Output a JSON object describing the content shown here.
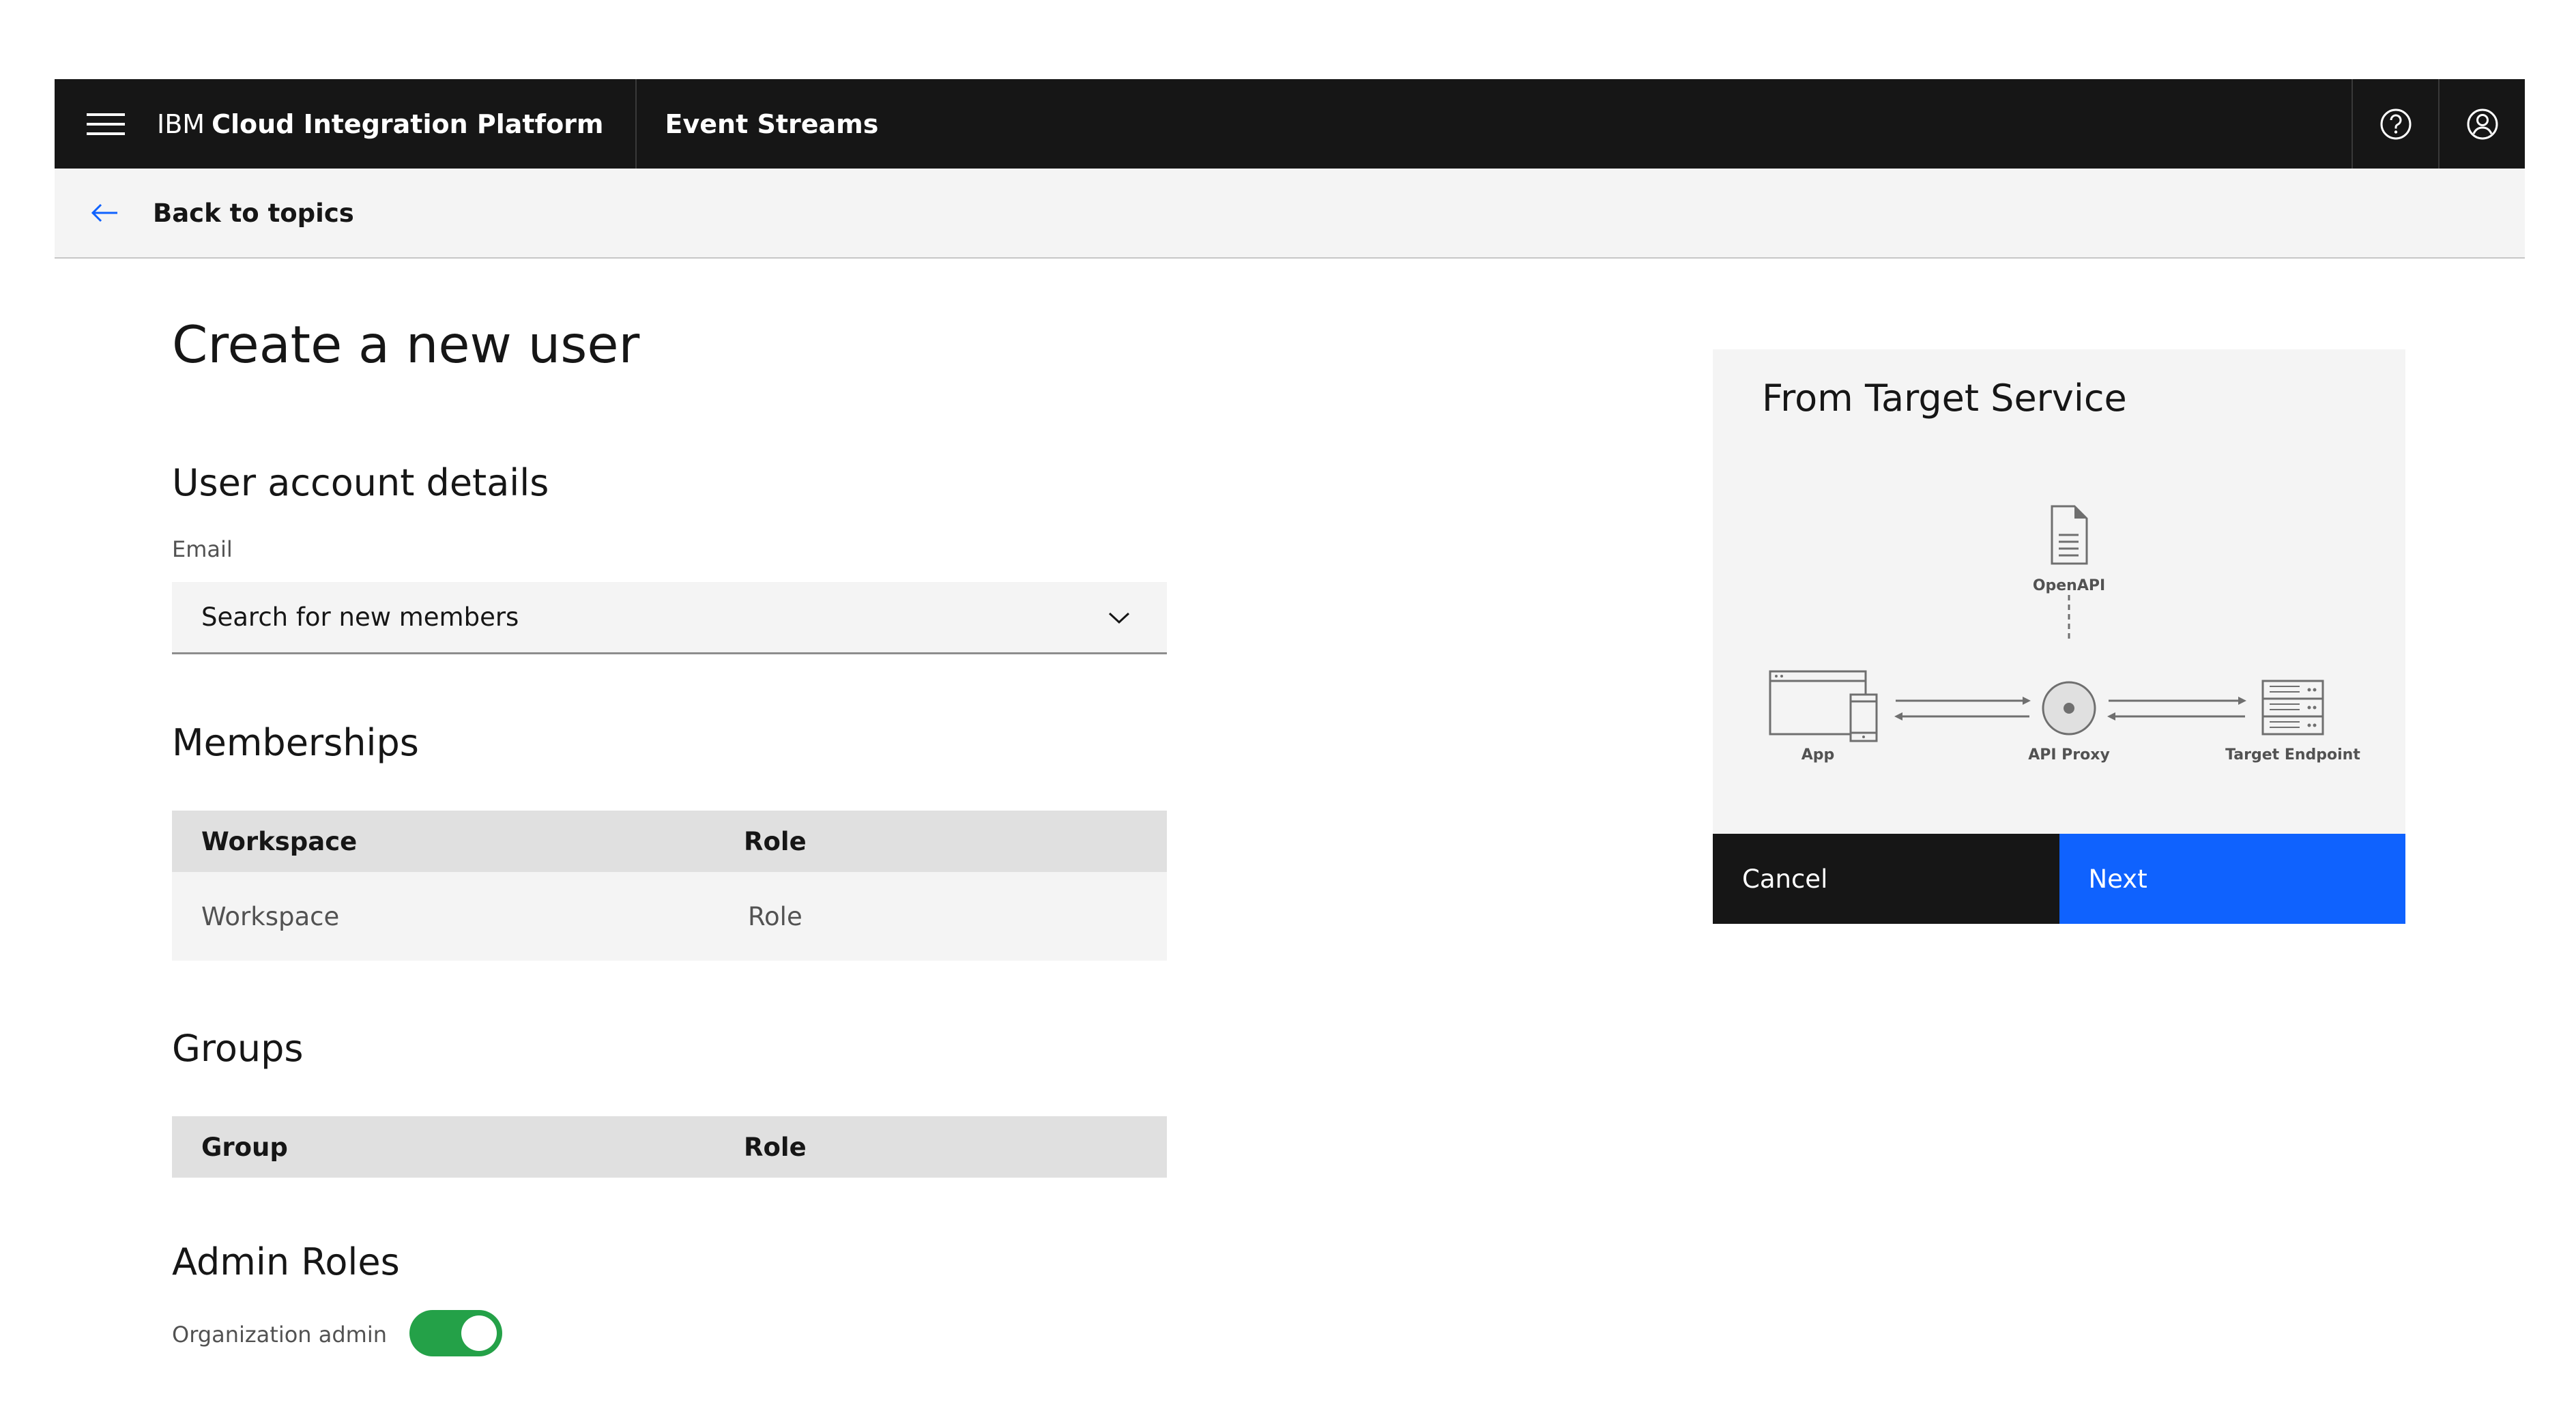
{
  "header": {
    "brand_prefix": "IBM",
    "brand_name": "Cloud Integration Platform",
    "product": "Event Streams",
    "icons": [
      "menu-icon",
      "help-icon",
      "user-icon"
    ]
  },
  "back_bar": {
    "label": "Back to topics"
  },
  "page": {
    "title": "Create a new user"
  },
  "user_account": {
    "title": "User account details",
    "email_label": "Email",
    "email_placeholder": "Search for new members"
  },
  "memberships": {
    "title": "Memberships",
    "columns": [
      "Workspace",
      "Role"
    ],
    "rows": [
      [
        "Workspace",
        "Role"
      ]
    ]
  },
  "groups": {
    "title": "Groups",
    "columns": [
      "Group",
      "Role"
    ]
  },
  "admin_roles": {
    "title": "Admin Roles",
    "toggle_label": "Organization admin",
    "toggle_on": true
  },
  "card": {
    "title": "From Target Service",
    "diagram": {
      "openapi": "OpenAPI",
      "app": "App",
      "proxy": "API Proxy",
      "endpoint": "Target Endpoint"
    },
    "cancel": "Cancel",
    "next": "Next"
  },
  "colors": {
    "header_bg": "#161616",
    "primary": "#0f62fe",
    "toggle_on": "#24a148",
    "field_bg": "#f4f4f4"
  }
}
